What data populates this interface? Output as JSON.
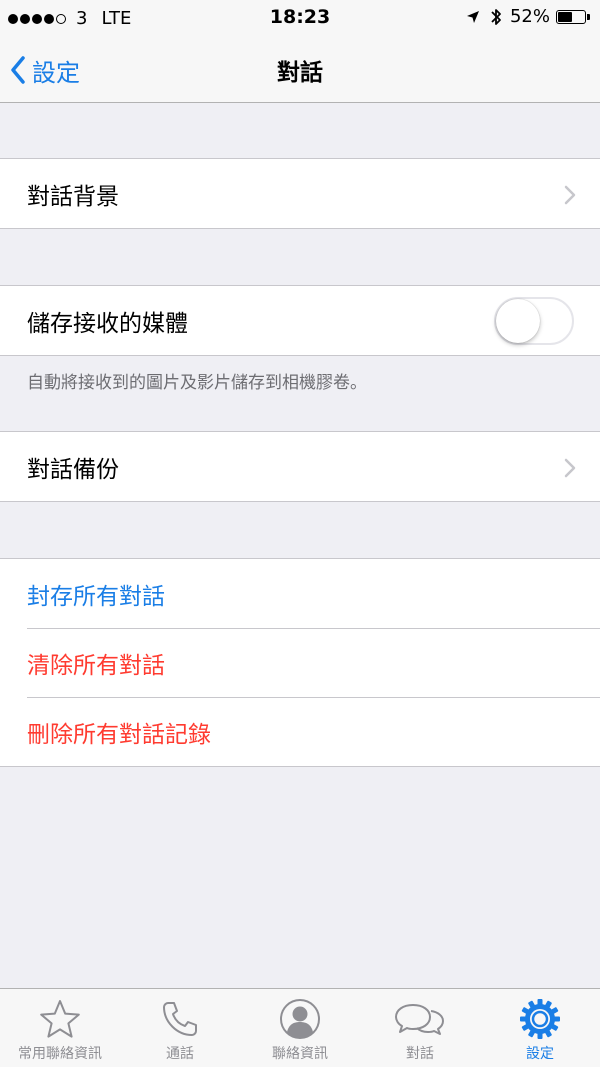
{
  "status_bar": {
    "carrier": "3",
    "network": "LTE",
    "time": "18:23",
    "battery_percent": "52%",
    "battery_level": 0.52,
    "signal_bars_filled": 4,
    "signal_bars_total": 5
  },
  "nav": {
    "back_label": "設定",
    "title": "對話"
  },
  "settings": {
    "chat_wallpaper": "對話背景",
    "save_media": "儲存接收的媒體",
    "save_media_enabled": false,
    "save_media_note": "自動將接收到的圖片及影片儲存到相機膠卷。",
    "chat_backup": "對話備份",
    "archive_all": "封存所有對話",
    "clear_all": "清除所有對話",
    "delete_all": "刪除所有對話記錄"
  },
  "tabs": [
    {
      "label": "常用聯絡資訊",
      "icon": "star-icon"
    },
    {
      "label": "通話",
      "icon": "phone-icon"
    },
    {
      "label": "聯絡資訊",
      "icon": "contact-icon"
    },
    {
      "label": "對話",
      "icon": "chat-bubbles-icon"
    },
    {
      "label": "設定",
      "icon": "gear-icon",
      "active": true
    }
  ],
  "colors": {
    "accent": "#1a7ee6",
    "destructive": "#ff3b30",
    "background": "#efeff4"
  }
}
